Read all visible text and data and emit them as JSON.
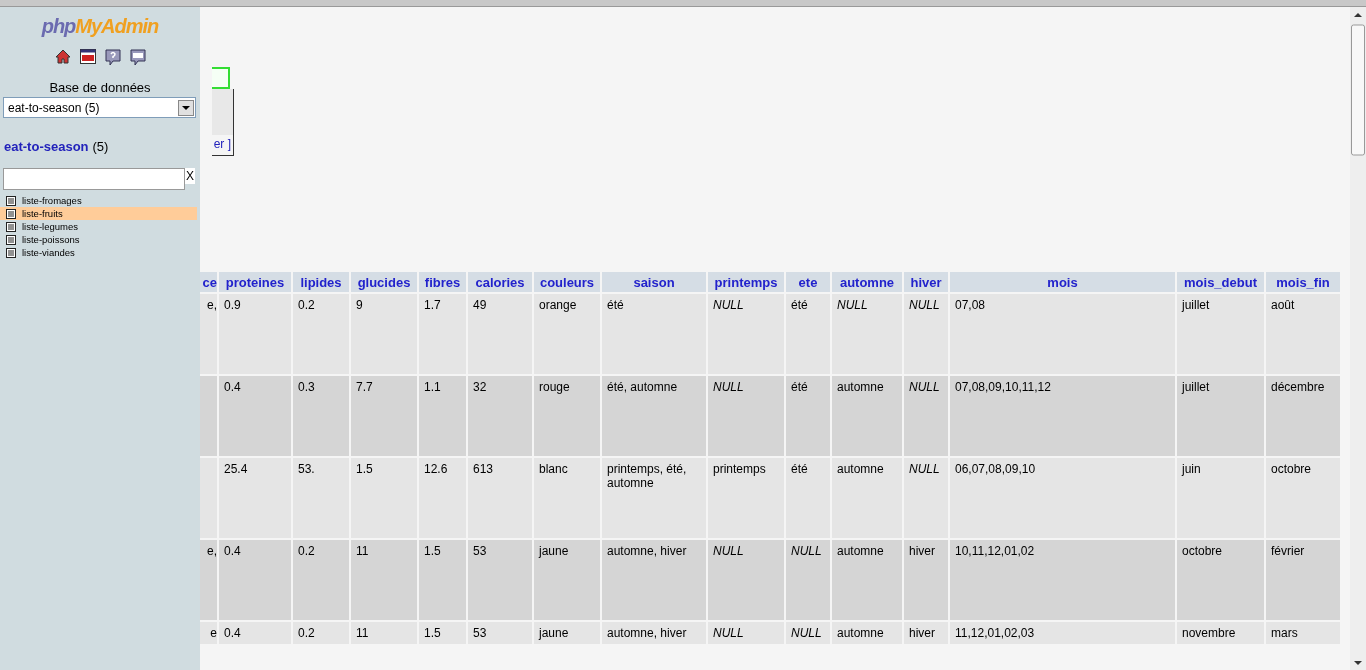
{
  "sidebar": {
    "logo": {
      "part1": "php",
      "part2": "MyAdmin"
    },
    "database_label": "Base de données",
    "database_select": {
      "value": "eat-to-season (5)"
    },
    "database_link": {
      "name": "eat-to-season",
      "count": "(5)"
    },
    "filter": {
      "clear": "X"
    },
    "tables": [
      {
        "label": "liste-fromages",
        "selected": false
      },
      {
        "label": "liste-fruits",
        "selected": true
      },
      {
        "label": "liste-legumes",
        "selected": false
      },
      {
        "label": "liste-poissons",
        "selected": false
      },
      {
        "label": "liste-viandes",
        "selected": false
      }
    ]
  },
  "main": {
    "panel_link": "er ]",
    "table": {
      "columns": [
        "ce",
        "proteines",
        "lipides",
        "glucides",
        "fibres",
        "calories",
        "couleurs",
        "saison",
        "printemps",
        "ete",
        "automne",
        "hiver",
        "mois",
        "mois_debut",
        "mois_fin"
      ],
      "rows": [
        {
          "cells": [
            "e,",
            "0.9",
            "0.2",
            "9",
            "1.7",
            "49",
            "orange",
            "été",
            {
              "kind": "null",
              "text": "NULL"
            },
            "été",
            {
              "kind": "null",
              "text": "NULL"
            },
            {
              "kind": "null",
              "text": "NULL"
            },
            "07,08",
            "juillet",
            "août"
          ]
        },
        {
          "cells": [
            "",
            "0.4",
            "0.3",
            "7.7",
            "1.1",
            "32",
            "rouge",
            "été, automne",
            {
              "kind": "null",
              "text": "NULL"
            },
            "été",
            "automne",
            {
              "kind": "null",
              "text": "NULL"
            },
            "07,08,09,10,11,12",
            "juillet",
            "décembre"
          ]
        },
        {
          "cells": [
            "",
            "25.4",
            "53.",
            "1.5",
            "12.6",
            "613",
            "blanc",
            "printemps, été, automne",
            "printemps",
            "été",
            "automne",
            {
              "kind": "null",
              "text": "NULL"
            },
            "06,07,08,09,10",
            "juin",
            "octobre"
          ]
        },
        {
          "cells": [
            "e,",
            "0.4",
            "0.2",
            "11",
            "1.5",
            "53",
            "jaune",
            "automne, hiver",
            {
              "kind": "null",
              "text": "NULL"
            },
            {
              "kind": "null",
              "text": "NULL"
            },
            "automne",
            "hiver",
            "10,11,12,01,02",
            "octobre",
            "février"
          ]
        },
        {
          "cells": [
            "e",
            "0.4",
            "0.2",
            "11",
            "1.5",
            "53",
            "jaune",
            "automne, hiver",
            {
              "kind": "null",
              "text": "NULL"
            },
            {
              "kind": "null",
              "text": "NULL"
            },
            "automne",
            "hiver",
            "11,12,01,02,03",
            "novembre",
            "mars"
          ]
        }
      ]
    }
  }
}
